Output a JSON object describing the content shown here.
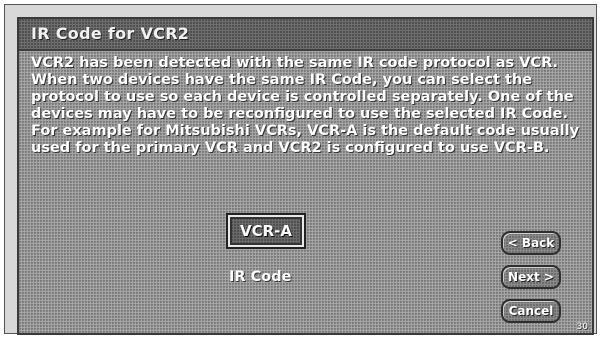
{
  "dialog": {
    "title": "IR Code for VCR2",
    "message": "VCR2 has been detected with the same IR code protocol as VCR. When two devices have the same IR Code, you can select the protocol to use so each device is controlled separately. One of the devices may have to be reconfigured to use the selected IR Code. For example for Mitsubishi VCRs, VCR-A is the default code usually used for the primary VCR and VCR2 is configured to use VCR-B."
  },
  "ir_code": {
    "selected_value": "VCR-A",
    "caption": "IR Code"
  },
  "buttons": {
    "back_label": "< Back",
    "next_label": "Next >",
    "cancel_label": "Cancel"
  },
  "page_mark": "30"
}
